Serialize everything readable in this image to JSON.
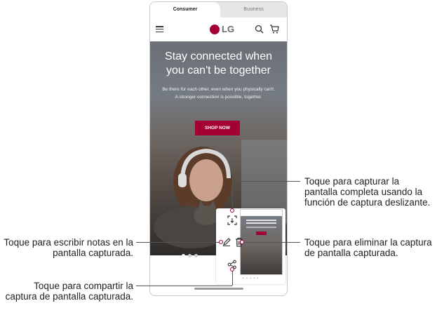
{
  "tabs": {
    "consumer": "Consumer",
    "business": "Business"
  },
  "brand": {
    "logo_text": "LG",
    "color": "#a50034"
  },
  "hero": {
    "title": "Stay connected when you can't be together",
    "subtitle": "Be there for each other, even when you physically can't. A stronger connection is possible, together.",
    "cta": "SHOP NOW"
  },
  "icons": {
    "menu": "hamburger-icon",
    "search": "search-icon",
    "cart": "cart-icon",
    "capture": "extended-capture-icon",
    "draw": "pencil-icon",
    "delete": "trash-icon",
    "share": "share-icon"
  },
  "callouts": {
    "capture": "Toque para capturar la pantalla completa usando la función de captura deslizante.",
    "delete": "Toque para eliminar la captura de pantalla capturada.",
    "draw": "Toque para escribir notas en la pantalla capturada.",
    "share": "Toque para compartir la captura de pantalla capturada."
  }
}
